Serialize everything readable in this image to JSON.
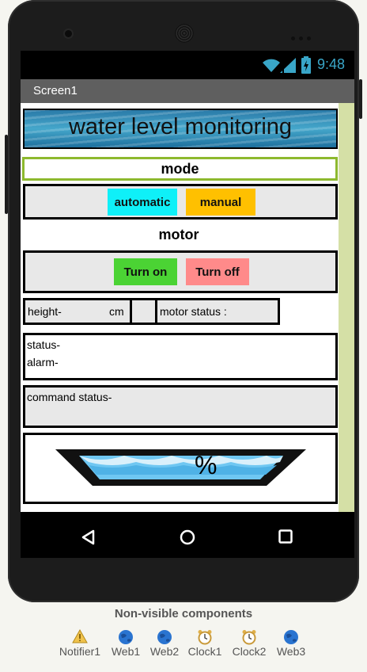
{
  "status_bar": {
    "time": "9:48"
  },
  "screen": {
    "title": "Screen1"
  },
  "header": {
    "banner_text": "water level monitoring"
  },
  "mode": {
    "label": "mode",
    "automatic_label": "automatic",
    "manual_label": "manual"
  },
  "motor": {
    "label": "motor",
    "turn_on_label": "Turn on",
    "turn_off_label": "Turn off"
  },
  "readings": {
    "height_label": "height-",
    "unit": "cm",
    "motor_status_label": "motor status :"
  },
  "info": {
    "status_label": "status-",
    "alarm_label": "alarm-",
    "command_status_label": "command status-"
  },
  "tank": {
    "percent_sign": "%"
  },
  "nonvisible": {
    "title": "Non-visible components",
    "items": [
      "Notifier1",
      "Web1",
      "Web2",
      "Clock1",
      "Clock2",
      "Web3"
    ]
  },
  "colors": {
    "automatic_button": "#0ff0f8",
    "manual_button": "#ffc000",
    "turn_on_button": "#4bd334",
    "turn_off_button": "#ff8a8a",
    "mode_border": "#8db92e",
    "scroll_track": "#d5e0a6",
    "title_bar": "#5f5f5f"
  }
}
